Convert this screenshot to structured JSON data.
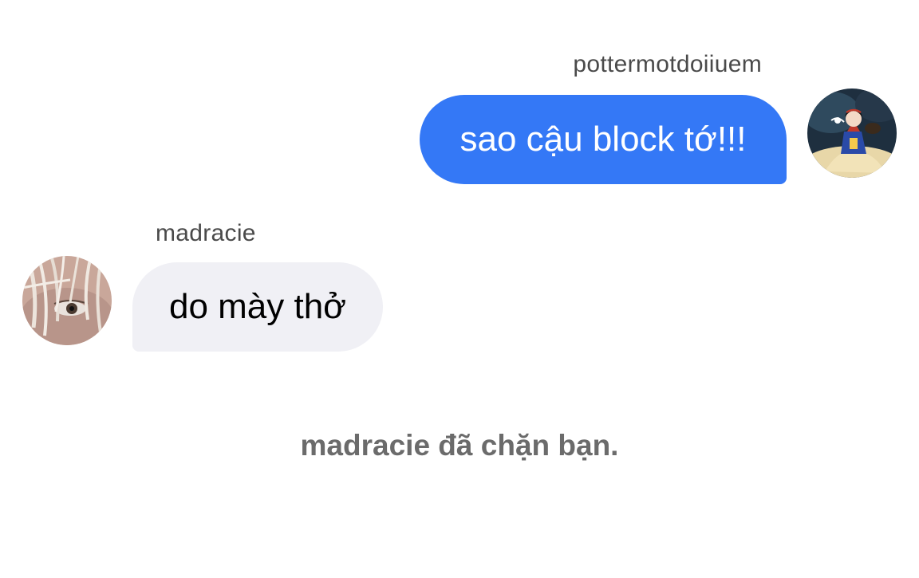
{
  "conversation": {
    "messages": [
      {
        "sender": "pottermotdoiiuem",
        "text": "sao cậu block tớ!!!",
        "direction": "outgoing",
        "bubble_color": "#3478f6"
      },
      {
        "sender": "madracie",
        "text": "do mày thở",
        "direction": "incoming",
        "bubble_color": "#f0f0f5"
      }
    ],
    "system_notice": "madracie đã chặn bạn."
  },
  "avatars": {
    "outgoing": "snow-white-illustration-avatar",
    "incoming": "face-with-hair-photo-avatar"
  }
}
